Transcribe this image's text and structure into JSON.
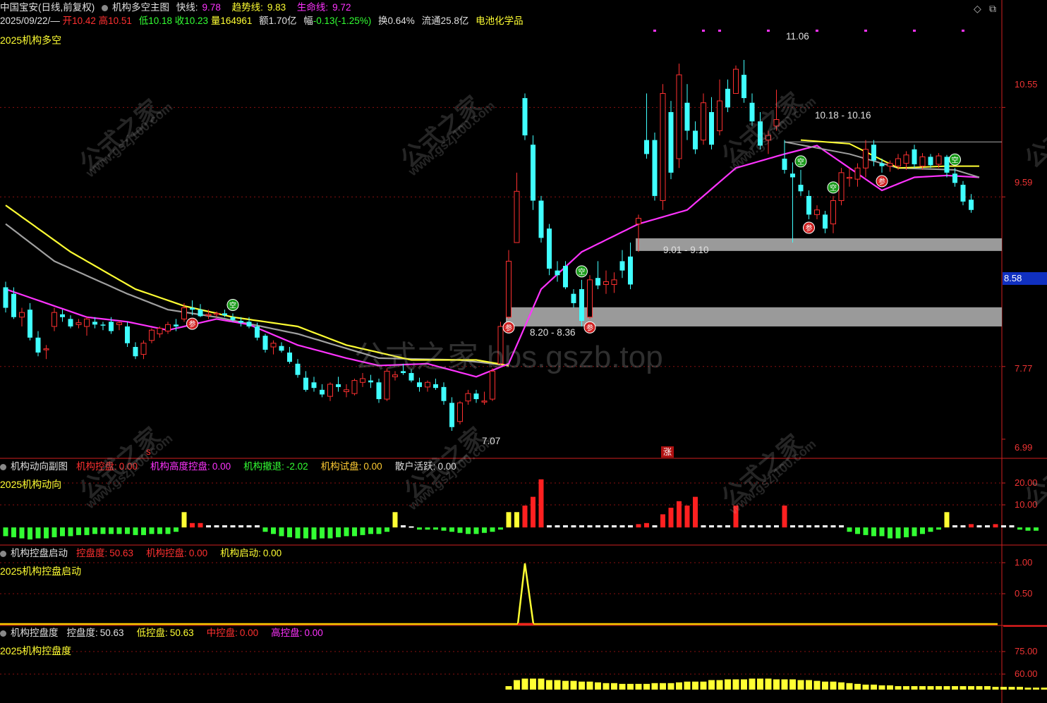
{
  "header": {
    "stock": "中国宝安(日线,前复权)",
    "indicator": "机构多空主图",
    "fast_label": "快线:",
    "fast_value": "9.78",
    "trend_label": "趋势线:",
    "trend_value": "9.83",
    "life_label": "生命线:",
    "life_value": "9.72",
    "date": "2025/09/22/—",
    "open_label": "开",
    "open": "10.42",
    "high_label": "高",
    "high": "10.51",
    "low_label": "低",
    "low": "10.18",
    "close_label": "收",
    "close": "10.23",
    "vol_label": "量",
    "vol": "164961",
    "amt_label": "额",
    "amt": "1.70亿",
    "chg_label": "幅",
    "chg": "-0.13(-1.25%)",
    "turn_label": "换",
    "turn": "0.64%",
    "float_label": "流通",
    "float": "25.8亿",
    "sector": "电池化学品",
    "subtitle": "2025机构多空"
  },
  "panel2": {
    "name": "机构动向副图",
    "items": [
      {
        "label": "机构控盘:",
        "value": "0.00",
        "color": "#ff3030"
      },
      {
        "label": "机构高度控盘:",
        "value": "0.00",
        "color": "#ff33ff"
      },
      {
        "label": "机构撤退:",
        "value": "-2.02",
        "color": "#33ff33"
      },
      {
        "label": "机构试盘:",
        "value": "0.00",
        "color": "#ffcc33"
      },
      {
        "label": "散户活跃:",
        "value": "0.00",
        "color": "#e0e0e0"
      }
    ],
    "subtitle": "2025机构动向"
  },
  "panel3": {
    "name": "机构控盘启动",
    "items": [
      {
        "label": "控盘度:",
        "value": "50.63",
        "color": "#ff3030"
      },
      {
        "label": "机构控盘:",
        "value": "0.00",
        "color": "#ff3030"
      },
      {
        "label": "机构启动:",
        "value": "0.00",
        "color": "#ffff33"
      }
    ],
    "subtitle": "2025机构控盘启动"
  },
  "panel4": {
    "name": "机构控盘度",
    "items": [
      {
        "label": "控盘度:",
        "value": "50.63",
        "color": "#e0e0e0"
      },
      {
        "label": "低控盘:",
        "value": "50.63",
        "color": "#ffff33"
      },
      {
        "label": "中控盘:",
        "value": "0.00",
        "color": "#ff3030"
      },
      {
        "label": "高控盘:",
        "value": "0.00",
        "color": "#ff33ff"
      }
    ],
    "subtitle": "2025机构控盘度"
  },
  "y_axis": {
    "main": [
      "10.55",
      "9.59",
      "7.77",
      "6.99"
    ],
    "panel2": [
      "20.00",
      "10.00"
    ],
    "panel3": [
      "1.00",
      "0.50"
    ],
    "panel4": [
      "75.00",
      "60.00"
    ],
    "current_price": "8.58"
  },
  "annotations": {
    "high_mark": "11.06",
    "low_mark": "7.07",
    "zone_upper": "10.18 - 10.16",
    "zone_mid": "9.01 - 9.10",
    "zone_low": "8.20 - 8.36",
    "rise_mark": "涨",
    "s_mark": "s",
    "buy_glyph": "参",
    "sell_glyph": "空"
  },
  "watermark": {
    "text": "公式之家",
    "url": "www.gszj100.com",
    "forum": "公式之家 bbs.gszb.top"
  },
  "controls": {
    "diamond": "◇",
    "window": "⧉"
  },
  "colors": {
    "up": "#ff3030",
    "down": "#40ffff",
    "fast": "#ff33ff",
    "trend": "#a0a0a0",
    "life": "#ffff33",
    "zone": "#9a9a9a",
    "grid": "#8b1010",
    "axis": "#d02020"
  },
  "chart_data": {
    "type": "candlestick",
    "ylim": [
      6.8,
      11.4
    ],
    "candles": [
      {
        "o": 8.62,
        "h": 8.68,
        "l": 8.35,
        "c": 8.4
      },
      {
        "o": 8.55,
        "h": 8.62,
        "l": 8.28,
        "c": 8.3
      },
      {
        "o": 8.3,
        "h": 8.4,
        "l": 8.2,
        "c": 8.35
      },
      {
        "o": 8.38,
        "h": 8.45,
        "l": 8.05,
        "c": 8.08
      },
      {
        "o": 8.08,
        "h": 8.15,
        "l": 7.88,
        "c": 7.92
      },
      {
        "o": 7.95,
        "h": 8.0,
        "l": 7.85,
        "c": 7.96
      },
      {
        "o": 8.2,
        "h": 8.4,
        "l": 8.15,
        "c": 8.35
      },
      {
        "o": 8.33,
        "h": 8.38,
        "l": 8.25,
        "c": 8.3
      },
      {
        "o": 8.28,
        "h": 8.32,
        "l": 8.18,
        "c": 8.2
      },
      {
        "o": 8.22,
        "h": 8.28,
        "l": 8.18,
        "c": 8.24
      },
      {
        "o": 8.2,
        "h": 8.3,
        "l": 8.1,
        "c": 8.28
      },
      {
        "o": 8.25,
        "h": 8.3,
        "l": 8.18,
        "c": 8.22
      },
      {
        "o": 8.22,
        "h": 8.25,
        "l": 8.16,
        "c": 8.21
      },
      {
        "o": 8.25,
        "h": 8.3,
        "l": 8.12,
        "c": 8.15
      },
      {
        "o": 8.22,
        "h": 8.26,
        "l": 8.16,
        "c": 8.24
      },
      {
        "o": 8.2,
        "h": 8.25,
        "l": 7.98,
        "c": 8.02
      },
      {
        "o": 7.98,
        "h": 8.03,
        "l": 7.85,
        "c": 7.88
      },
      {
        "o": 7.9,
        "h": 8.05,
        "l": 7.85,
        "c": 8.02
      },
      {
        "o": 8.05,
        "h": 8.18,
        "l": 8.02,
        "c": 8.16
      },
      {
        "o": 8.12,
        "h": 8.2,
        "l": 8.08,
        "c": 8.18
      },
      {
        "o": 8.15,
        "h": 8.25,
        "l": 8.12,
        "c": 8.22
      },
      {
        "o": 8.22,
        "h": 8.28,
        "l": 8.15,
        "c": 8.2
      },
      {
        "o": 8.28,
        "h": 8.45,
        "l": 8.25,
        "c": 8.4
      },
      {
        "o": 8.4,
        "h": 8.48,
        "l": 8.32,
        "c": 8.38
      },
      {
        "o": 8.38,
        "h": 8.44,
        "l": 8.3,
        "c": 8.31
      },
      {
        "o": 8.32,
        "h": 8.38,
        "l": 8.28,
        "c": 8.33
      },
      {
        "o": 8.33,
        "h": 8.36,
        "l": 8.3,
        "c": 8.34
      },
      {
        "o": 8.34,
        "h": 8.38,
        "l": 8.3,
        "c": 8.32
      },
      {
        "o": 8.3,
        "h": 8.34,
        "l": 8.25,
        "c": 8.27
      },
      {
        "o": 8.26,
        "h": 8.3,
        "l": 8.2,
        "c": 8.24
      },
      {
        "o": 8.25,
        "h": 8.3,
        "l": 8.18,
        "c": 8.2
      },
      {
        "o": 8.2,
        "h": 8.24,
        "l": 8.05,
        "c": 8.08
      },
      {
        "o": 8.1,
        "h": 8.12,
        "l": 7.92,
        "c": 7.95
      },
      {
        "o": 7.98,
        "h": 8.05,
        "l": 7.9,
        "c": 8.02
      },
      {
        "o": 7.99,
        "h": 8.03,
        "l": 7.92,
        "c": 7.94
      },
      {
        "o": 7.92,
        "h": 7.98,
        "l": 7.8,
        "c": 7.82
      },
      {
        "o": 7.8,
        "h": 7.85,
        "l": 7.65,
        "c": 7.68
      },
      {
        "o": 7.65,
        "h": 7.72,
        "l": 7.5,
        "c": 7.52
      },
      {
        "o": 7.6,
        "h": 7.66,
        "l": 7.5,
        "c": 7.54
      },
      {
        "o": 7.52,
        "h": 7.58,
        "l": 7.44,
        "c": 7.47
      },
      {
        "o": 7.45,
        "h": 7.6,
        "l": 7.4,
        "c": 7.58
      },
      {
        "o": 7.58,
        "h": 7.66,
        "l": 7.5,
        "c": 7.55
      },
      {
        "o": 7.5,
        "h": 7.58,
        "l": 7.44,
        "c": 7.52
      },
      {
        "o": 7.48,
        "h": 7.64,
        "l": 7.46,
        "c": 7.62
      },
      {
        "o": 7.6,
        "h": 7.7,
        "l": 7.55,
        "c": 7.64
      },
      {
        "o": 7.62,
        "h": 7.68,
        "l": 7.54,
        "c": 7.6
      },
      {
        "o": 7.6,
        "h": 7.64,
        "l": 7.38,
        "c": 7.42
      },
      {
        "o": 7.42,
        "h": 7.75,
        "l": 7.4,
        "c": 7.72
      },
      {
        "o": 7.66,
        "h": 7.72,
        "l": 7.62,
        "c": 7.68
      },
      {
        "o": 7.72,
        "h": 7.8,
        "l": 7.68,
        "c": 7.7
      },
      {
        "o": 7.7,
        "h": 7.74,
        "l": 7.6,
        "c": 7.62
      },
      {
        "o": 7.6,
        "h": 7.65,
        "l": 7.5,
        "c": 7.55
      },
      {
        "o": 7.55,
        "h": 7.62,
        "l": 7.5,
        "c": 7.6
      },
      {
        "o": 7.58,
        "h": 7.64,
        "l": 7.52,
        "c": 7.54
      },
      {
        "o": 7.55,
        "h": 7.6,
        "l": 7.36,
        "c": 7.4
      },
      {
        "o": 7.38,
        "h": 7.44,
        "l": 7.08,
        "c": 7.12
      },
      {
        "o": 7.18,
        "h": 7.4,
        "l": 7.15,
        "c": 7.38
      },
      {
        "o": 7.4,
        "h": 7.52,
        "l": 7.36,
        "c": 7.48
      },
      {
        "o": 7.48,
        "h": 7.52,
        "l": 7.38,
        "c": 7.42
      },
      {
        "o": 7.4,
        "h": 7.5,
        "l": 7.36,
        "c": 7.4
      },
      {
        "o": 7.42,
        "h": 7.75,
        "l": 7.4,
        "c": 7.72
      },
      {
        "o": 7.8,
        "h": 8.25,
        "l": 7.78,
        "c": 8.2
      },
      {
        "o": 8.3,
        "h": 9.02,
        "l": 8.28,
        "c": 8.9
      },
      {
        "o": 9.1,
        "h": 9.85,
        "l": 9.1,
        "c": 9.65
      },
      {
        "o": 10.65,
        "h": 10.7,
        "l": 10.2,
        "c": 10.25
      },
      {
        "o": 10.15,
        "h": 10.25,
        "l": 9.45,
        "c": 9.55
      },
      {
        "o": 9.55,
        "h": 9.6,
        "l": 9.1,
        "c": 9.15
      },
      {
        "o": 9.25,
        "h": 9.3,
        "l": 8.75,
        "c": 8.82
      },
      {
        "o": 8.8,
        "h": 8.9,
        "l": 8.68,
        "c": 8.75
      },
      {
        "o": 8.85,
        "h": 8.9,
        "l": 8.6,
        "c": 8.62
      },
      {
        "o": 8.55,
        "h": 8.6,
        "l": 8.4,
        "c": 8.45
      },
      {
        "o": 8.6,
        "h": 8.7,
        "l": 8.2,
        "c": 8.26
      },
      {
        "o": 8.3,
        "h": 8.75,
        "l": 8.28,
        "c": 8.7
      },
      {
        "o": 8.72,
        "h": 8.9,
        "l": 8.6,
        "c": 8.64
      },
      {
        "o": 8.65,
        "h": 8.8,
        "l": 8.55,
        "c": 8.68
      },
      {
        "o": 8.65,
        "h": 8.78,
        "l": 8.56,
        "c": 8.7
      },
      {
        "o": 8.9,
        "h": 9.02,
        "l": 8.72,
        "c": 8.8
      },
      {
        "o": 8.95,
        "h": 9.1,
        "l": 8.6,
        "c": 8.65
      },
      {
        "o": 9.3,
        "h": 9.4,
        "l": 9.0,
        "c": 9.36
      },
      {
        "o": 10.2,
        "h": 10.7,
        "l": 10.0,
        "c": 10.05
      },
      {
        "o": 10.2,
        "h": 10.28,
        "l": 9.55,
        "c": 9.6
      },
      {
        "o": 9.55,
        "h": 10.8,
        "l": 9.45,
        "c": 10.7
      },
      {
        "o": 10.5,
        "h": 10.62,
        "l": 9.78,
        "c": 9.85
      },
      {
        "o": 10.0,
        "h": 11.02,
        "l": 9.9,
        "c": 10.9
      },
      {
        "o": 10.6,
        "h": 10.8,
        "l": 10.2,
        "c": 10.3
      },
      {
        "o": 10.3,
        "h": 10.4,
        "l": 10.05,
        "c": 10.1
      },
      {
        "o": 10.2,
        "h": 10.7,
        "l": 10.15,
        "c": 10.6
      },
      {
        "o": 10.5,
        "h": 10.66,
        "l": 10.1,
        "c": 10.15
      },
      {
        "o": 10.3,
        "h": 10.85,
        "l": 10.25,
        "c": 10.62
      },
      {
        "o": 10.75,
        "h": 10.85,
        "l": 10.5,
        "c": 10.55
      },
      {
        "o": 10.7,
        "h": 11.0,
        "l": 10.7,
        "c": 10.96
      },
      {
        "o": 10.9,
        "h": 11.06,
        "l": 10.6,
        "c": 10.65
      },
      {
        "o": 10.6,
        "h": 10.7,
        "l": 10.35,
        "c": 10.4
      },
      {
        "o": 10.4,
        "h": 10.5,
        "l": 10.1,
        "c": 10.14
      },
      {
        "o": 10.2,
        "h": 10.3,
        "l": 10.05,
        "c": 10.25
      },
      {
        "o": 10.35,
        "h": 10.74,
        "l": 10.3,
        "c": 10.42
      },
      {
        "o": 10.0,
        "h": 10.2,
        "l": 9.84,
        "c": 9.88
      },
      {
        "o": 9.84,
        "h": 9.96,
        "l": 9.1,
        "c": 9.8
      },
      {
        "o": 9.72,
        "h": 9.88,
        "l": 9.6,
        "c": 9.65
      },
      {
        "o": 9.6,
        "h": 9.66,
        "l": 9.35,
        "c": 9.4
      },
      {
        "o": 9.4,
        "h": 9.5,
        "l": 9.35,
        "c": 9.45
      },
      {
        "o": 9.4,
        "h": 9.44,
        "l": 9.2,
        "c": 9.25
      },
      {
        "o": 9.3,
        "h": 9.6,
        "l": 9.2,
        "c": 9.55
      },
      {
        "o": 9.55,
        "h": 9.9,
        "l": 9.5,
        "c": 9.85
      },
      {
        "o": 9.8,
        "h": 9.9,
        "l": 9.7,
        "c": 9.8
      },
      {
        "o": 9.78,
        "h": 9.95,
        "l": 9.7,
        "c": 9.9
      },
      {
        "o": 9.9,
        "h": 10.2,
        "l": 9.8,
        "c": 10.1
      },
      {
        "o": 10.15,
        "h": 10.2,
        "l": 9.92,
        "c": 9.98
      },
      {
        "o": 9.95,
        "h": 10.0,
        "l": 9.85,
        "c": 9.92
      },
      {
        "o": 9.92,
        "h": 9.98,
        "l": 9.86,
        "c": 9.95
      },
      {
        "o": 9.92,
        "h": 10.05,
        "l": 9.88,
        "c": 10.0
      },
      {
        "o": 9.95,
        "h": 10.08,
        "l": 9.88,
        "c": 10.04
      },
      {
        "o": 10.1,
        "h": 10.15,
        "l": 9.9,
        "c": 9.94
      },
      {
        "o": 9.92,
        "h": 10.06,
        "l": 9.88,
        "c": 10.02
      },
      {
        "o": 10.02,
        "h": 10.05,
        "l": 9.9,
        "c": 9.93
      },
      {
        "o": 9.94,
        "h": 10.06,
        "l": 9.9,
        "c": 10.03
      },
      {
        "o": 10.02,
        "h": 10.04,
        "l": 9.8,
        "c": 9.85
      },
      {
        "o": 9.84,
        "h": 9.9,
        "l": 9.7,
        "c": 9.74
      },
      {
        "o": 9.72,
        "h": 9.76,
        "l": 9.5,
        "c": 9.54
      },
      {
        "o": 9.56,
        "h": 9.62,
        "l": 9.42,
        "c": 9.45
      }
    ],
    "lines": {
      "fast": {
        "color": "#ff33ff",
        "start": 8.6,
        "points": [
          [
            0,
            8.6
          ],
          [
            10,
            8.3
          ],
          [
            15,
            8.25
          ],
          [
            20,
            8.16
          ],
          [
            26,
            8.28
          ],
          [
            30,
            8.22
          ],
          [
            36,
            8.0
          ],
          [
            42,
            7.86
          ],
          [
            46,
            7.78
          ],
          [
            52,
            7.8
          ],
          [
            58,
            7.66
          ],
          [
            62,
            7.8
          ],
          [
            66,
            8.6
          ],
          [
            71,
            9.0
          ],
          [
            78,
            9.3
          ],
          [
            84,
            9.45
          ],
          [
            90,
            9.9
          ],
          [
            96,
            10.05
          ],
          [
            100,
            10.14
          ],
          [
            104,
            9.9
          ],
          [
            108,
            9.66
          ],
          [
            112,
            9.8
          ],
          [
            116,
            9.82
          ],
          [
            120,
            9.8
          ]
        ]
      },
      "trend": {
        "color": "#a0a0a0",
        "points": [
          [
            0,
            9.3
          ],
          [
            6,
            8.9
          ],
          [
            15,
            8.55
          ],
          [
            20,
            8.38
          ],
          [
            26,
            8.3
          ],
          [
            36,
            8.12
          ],
          [
            46,
            7.86
          ],
          [
            56,
            7.84
          ],
          [
            62,
            7.78
          ]
        ]
      },
      "life": {
        "color": "#ffff33",
        "points": [
          [
            0,
            9.5
          ],
          [
            8,
            9.0
          ],
          [
            16,
            8.6
          ],
          [
            22,
            8.42
          ],
          [
            28,
            8.3
          ],
          [
            36,
            8.2
          ],
          [
            42,
            8.0
          ],
          [
            50,
            7.84
          ],
          [
            58,
            7.84
          ],
          [
            62,
            7.78
          ]
        ]
      }
    },
    "signals": [
      {
        "i": 23,
        "t": "buy"
      },
      {
        "i": 28,
        "t": "sell"
      },
      {
        "i": 62,
        "t": "buy"
      },
      {
        "i": 71,
        "t": "sell"
      },
      {
        "i": 72,
        "t": "buy"
      },
      {
        "i": 98,
        "t": "sell"
      },
      {
        "i": 99,
        "t": "buy"
      },
      {
        "i": 102,
        "t": "sell"
      },
      {
        "i": 108,
        "t": "buy"
      },
      {
        "i": 117,
        "t": "sell"
      }
    ],
    "zones": [
      {
        "label": "10.18 - 10.16",
        "lo": 10.16,
        "hi": 10.18,
        "from": 96
      },
      {
        "label": "9.01 - 9.10",
        "lo": 9.01,
        "hi": 9.1,
        "from": 78
      },
      {
        "label": "8.20 - 8.36",
        "lo": 8.2,
        "hi": 8.36,
        "from": 62
      }
    ],
    "panel2_bars": [
      -4,
      -4.5,
      -5,
      -5.5,
      -5,
      -5,
      -4.5,
      -4,
      -4,
      -3.5,
      -3.5,
      -3,
      -3,
      -3,
      -3,
      -3,
      -3.5,
      -3.5,
      -3,
      -3,
      -3,
      -2,
      7,
      2,
      2,
      1,
      1,
      1,
      1,
      1,
      1,
      1,
      -2,
      -3,
      -4,
      -4.5,
      -5,
      -5,
      -5.5,
      -5,
      -5,
      -4.5,
      -4,
      -4,
      -3.5,
      -3,
      -3,
      -2,
      7,
      1,
      0.5,
      -1,
      -1,
      -1,
      -1.5,
      -2,
      -2.5,
      -3,
      -3,
      -2.5,
      -2,
      -1,
      7,
      7,
      10,
      14,
      22,
      1,
      1,
      1,
      1,
      1,
      1,
      1,
      1,
      1,
      1,
      1,
      1.5,
      2,
      1,
      6,
      9,
      12,
      10,
      14,
      1,
      1,
      1,
      1,
      10,
      1,
      1,
      1,
      1,
      1,
      10,
      1,
      1,
      1,
      1,
      1,
      1,
      1,
      -2,
      -3,
      -3.5,
      -4,
      -4,
      -5,
      -5,
      -4.5,
      -4,
      -3,
      -2,
      -1,
      7,
      1,
      1,
      1.5,
      1,
      1,
      1.5,
      1,
      1,
      -1,
      -1.5,
      -1.5
    ],
    "panel3_peak": {
      "i": 64,
      "value": 1.0
    },
    "panel4_values": [
      52,
      56,
      57,
      57,
      57,
      56,
      56,
      55.5,
      55.5,
      55,
      55,
      54.5,
      54,
      54,
      53.5,
      53.5,
      53.5,
      53.5,
      54,
      54,
      54,
      54.5,
      55,
      55,
      55,
      56,
      56,
      56.5,
      56.5,
      56.5,
      57,
      57,
      57,
      56.5,
      56.5,
      56.5,
      56,
      56,
      55.5,
      55,
      55,
      54.5,
      54,
      53.5,
      53,
      53,
      52.5,
      52.5,
      52,
      52,
      52,
      52,
      52,
      52,
      52,
      52,
      52,
      52,
      52,
      52,
      51.5,
      51.5,
      51.5,
      51.5,
      51,
      51,
      51,
      51
    ],
    "panel4_start": 62
  }
}
